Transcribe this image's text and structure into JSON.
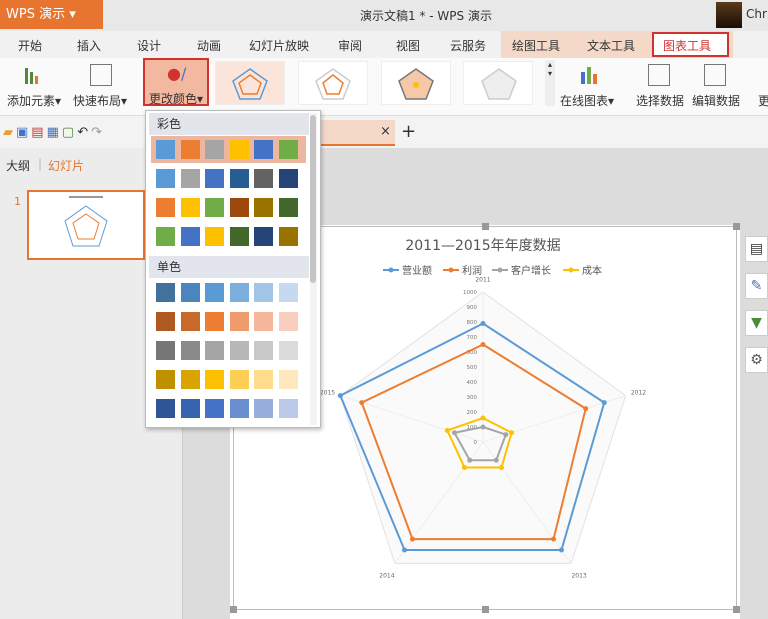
{
  "app": {
    "menu_button": "WPS 演示",
    "doc_title": "演示文稿1 * - WPS 演示",
    "user": "Chri"
  },
  "tabs": [
    "开始",
    "插入",
    "设计",
    "动画",
    "幻灯片放映",
    "审阅",
    "视图",
    "云服务",
    "绘图工具",
    "文本工具",
    "图表工具"
  ],
  "ribbon": {
    "add_element": "添加元素",
    "quick_layout": "快速布局",
    "change_color": "更改颜色",
    "online_chart": "在线图表",
    "select_data": "选择数据",
    "edit_data": "编辑数据",
    "more": "更"
  },
  "doc_tab": {
    "close": "×",
    "add": "+"
  },
  "left_panel": {
    "outline": "大纲",
    "slides": "幻灯片",
    "slide_number": "1"
  },
  "color_menu": {
    "colorful_label": "彩色",
    "mono_label": "单色",
    "colorful": [
      [
        "#5b9bd5",
        "#ed7d31",
        "#a5a5a5",
        "#ffc000",
        "#4472c4",
        "#70ad47"
      ],
      [
        "#5b9bd5",
        "#a5a5a5",
        "#4472c4",
        "#255e91",
        "#636363",
        "#264478"
      ],
      [
        "#ed7d31",
        "#ffc000",
        "#70ad47",
        "#9e480e",
        "#997300",
        "#43682b"
      ],
      [
        "#70ad47",
        "#4472c4",
        "#ffc000",
        "#43682b",
        "#264478",
        "#997300"
      ]
    ],
    "mono": [
      [
        "#41719c",
        "#4a86bd",
        "#5b9bd5",
        "#7cafdd",
        "#a3c5e8",
        "#c5d9f0"
      ],
      [
        "#ae5a21",
        "#c8682b",
        "#ed7d31",
        "#f09b6b",
        "#f5b69a",
        "#f8cfbf"
      ],
      [
        "#767676",
        "#8a8a8a",
        "#a5a5a5",
        "#b7b7b7",
        "#c9c9c9",
        "#dbdbdb"
      ],
      [
        "#bf9000",
        "#d9a300",
        "#ffc000",
        "#ffcf55",
        "#ffdc8c",
        "#ffe8bd"
      ],
      [
        "#2f5597",
        "#3764ae",
        "#4472c4",
        "#6b8ed0",
        "#97aedc",
        "#bcc9e8"
      ]
    ]
  },
  "chart_data": {
    "type": "radar",
    "title": "2011—2015年年度数据",
    "categories": [
      "2011",
      "2012",
      "2013",
      "2014",
      "2015"
    ],
    "rmax": 1000,
    "ticks": [
      0,
      100,
      200,
      300,
      400,
      500,
      600,
      700,
      800,
      900,
      1000
    ],
    "series": [
      {
        "name": "营业额",
        "color": "#5b9bd5",
        "values": [
          790,
          850,
          890,
          890,
          1000
        ]
      },
      {
        "name": "利润",
        "color": "#ed7d31",
        "values": [
          650,
          720,
          800,
          800,
          850
        ]
      },
      {
        "name": "客户增长",
        "color": "#a5a5a5",
        "values": [
          100,
          160,
          150,
          150,
          200
        ]
      },
      {
        "name": "成本",
        "color": "#ffc000",
        "values": [
          160,
          200,
          210,
          210,
          250
        ]
      }
    ]
  }
}
